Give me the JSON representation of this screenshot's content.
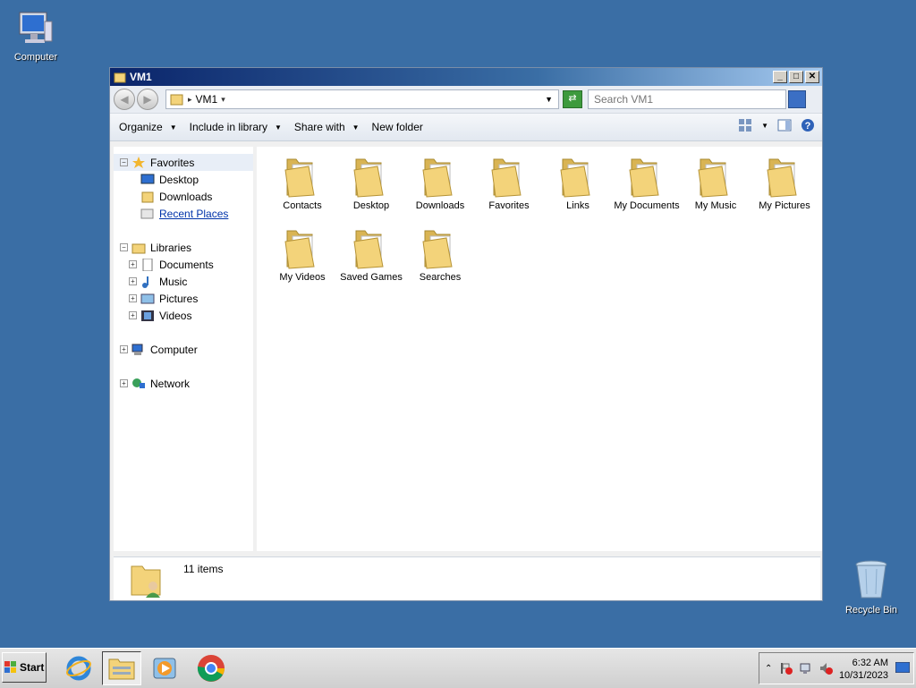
{
  "desktop": {
    "computer_label": "Computer",
    "recycle_label": "Recycle Bin"
  },
  "window": {
    "title": "VM1",
    "address": "VM1",
    "search_placeholder": "Search VM1",
    "toolbar": {
      "organize": "Organize",
      "include": "Include in library",
      "share": "Share with",
      "new_folder": "New folder"
    },
    "nav": {
      "favorites": "Favorites",
      "desktop": "Desktop",
      "downloads": "Downloads",
      "recent": "Recent Places",
      "libraries": "Libraries",
      "documents": "Documents",
      "music": "Music",
      "pictures": "Pictures",
      "videos": "Videos",
      "computer": "Computer",
      "network": "Network"
    },
    "files": [
      {
        "label": "Contacts",
        "icon": "contacts-folder-icon"
      },
      {
        "label": "Desktop",
        "icon": "desktop-folder-icon"
      },
      {
        "label": "Downloads",
        "icon": "downloads-folder-icon"
      },
      {
        "label": "Favorites",
        "icon": "favorites-folder-icon"
      },
      {
        "label": "Links",
        "icon": "links-folder-icon"
      },
      {
        "label": "My Documents",
        "icon": "documents-folder-icon"
      },
      {
        "label": "My Music",
        "icon": "music-folder-icon"
      },
      {
        "label": "My Pictures",
        "icon": "pictures-folder-icon"
      },
      {
        "label": "My Videos",
        "icon": "videos-folder-icon"
      },
      {
        "label": "Saved Games",
        "icon": "games-folder-icon"
      },
      {
        "label": "Searches",
        "icon": "searches-folder-icon"
      }
    ],
    "status": "11 items"
  },
  "taskbar": {
    "start_label": "Start",
    "time": "6:32 AM",
    "date": "10/31/2023"
  },
  "colors": {
    "desktop_bg": "#3a6ea5",
    "folder": "#f3d37a",
    "accent": "#3b6fc4"
  }
}
